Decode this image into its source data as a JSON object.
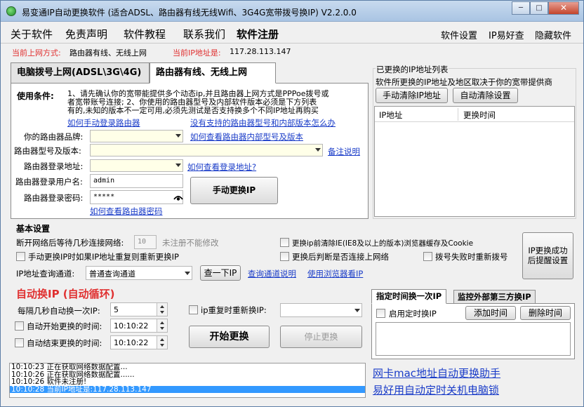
{
  "window": {
    "title": "易变通IP自动更换软件 (适合ADSL、路由器有线无线Wifi、3G4G宽带拨号换IP) V2.2.0.0",
    "minimize": "─",
    "maximize": "□",
    "close": "✕"
  },
  "menu": {
    "left": [
      "关于软件",
      "免责声明",
      "软件教程",
      "联系我们",
      "软件注册"
    ],
    "right": [
      "软件设置",
      "IP易好查",
      "隐藏软件"
    ]
  },
  "status": {
    "mode_label": "当前上网方式:",
    "mode_value": "路由器有线、无线上网",
    "ip_label": "当前IP地址是:",
    "ip_value": "117.28.113.147"
  },
  "tabs": [
    "电脑拨号上网(ADSL\\3G\\4G)",
    "路由器有线、无线上网"
  ],
  "router_panel": {
    "conditions_label": "使用条件:",
    "conditions_text_1": "1、请先确认你的宽带能提供多个动态ip,并且路由器上网方式是PPPoe拨号或",
    "conditions_text_2": "者宽带账号连接;    2、你使用的路由器型号及内部软件版本必须是下方列表",
    "conditions_text_3": "有的,未知的版本不一定可用,必须先测试是否支持换多个不同IP地址再购买",
    "link_login": "如何手动登录路由器",
    "link_unsupported": "没有支持的路由器型号和内部版本怎么办",
    "brand_label": "你的路由器品牌:",
    "link_view_model": "如何查看路由器内部型号及版本",
    "model_label": "路由器型号及版本:",
    "link_note": "备注说明",
    "address_label": "路由器登录地址:",
    "link_address": "如何查看登录地址?",
    "username_label": "路由器登录用户名:",
    "username_value": "admin",
    "password_label": "路由器登录密码:",
    "password_value": "*****",
    "manual_button": "手动更换IP",
    "link_password": "如何查看路由器密码"
  },
  "history": {
    "title": "已更换的IP地址列表",
    "subtitle": "软件所更换的IP地址及地区取决于你的宽带提供商",
    "clear_manual": "手动清除IP地址",
    "clear_auto": "自动清除设置",
    "col_ip": "IP地址",
    "col_time": "更换时间"
  },
  "basic": {
    "title": "基本设置",
    "wait_label": "断开网络后等待几秒连接网络:",
    "wait_value": "10",
    "wait_note": "未注册不能修改",
    "clear_ie": "更换ip前清除IE(IE8及以上的版本)浏览器缓存及Cookie",
    "manual_repeat": "手动更换IP时如果IP地址重复则重新更换IP",
    "check_connected": "更换后判断是否连接上网络",
    "redial_fail": "拨号失败时重新拨号",
    "query_label": "IP地址查询通道:",
    "query_value": "普通查询通道",
    "query_button": "查一下IP",
    "link_query_help": "查询通道说明",
    "link_browser": "使用浏览器看IP",
    "notify_button_1": "IP更换成功",
    "notify_button_2": "后提醒设置"
  },
  "auto": {
    "title": "自动换IP (自动循环)",
    "interval_label": "每隔几秒自动换一次IP:",
    "interval_value": "5",
    "start_time_label": "自动开始更换的时间:",
    "start_time_value": "10:10:22",
    "end_time_label": "自动结束更换的时间:",
    "end_time_value": "10:10:22",
    "repeat_label": "ip重复时重新换IP:",
    "start_button": "开始更换",
    "stop_button": "停止更换"
  },
  "schedule": {
    "tabs": [
      "指定时间换一次IP",
      "监控外部第三方换IP"
    ],
    "enable_label": "启用定时换IP",
    "add_button": "添加时间",
    "delete_button": "删除时间"
  },
  "log": [
    {
      "time": "10:10:23",
      "text": "正在获取网络数据配置..."
    },
    {
      "time": "10:10:26",
      "text": "正在获取网络数据配置......"
    },
    {
      "time": "10:10:26",
      "text": "软件未注册!"
    },
    {
      "time": "10:10:28",
      "text": "当前IP地址是:117.28.113.147"
    }
  ],
  "promo": {
    "link_mac": "网卡mac地址自动更换助手",
    "link_shutdown": "易好用自动定时关机电脑锁"
  }
}
